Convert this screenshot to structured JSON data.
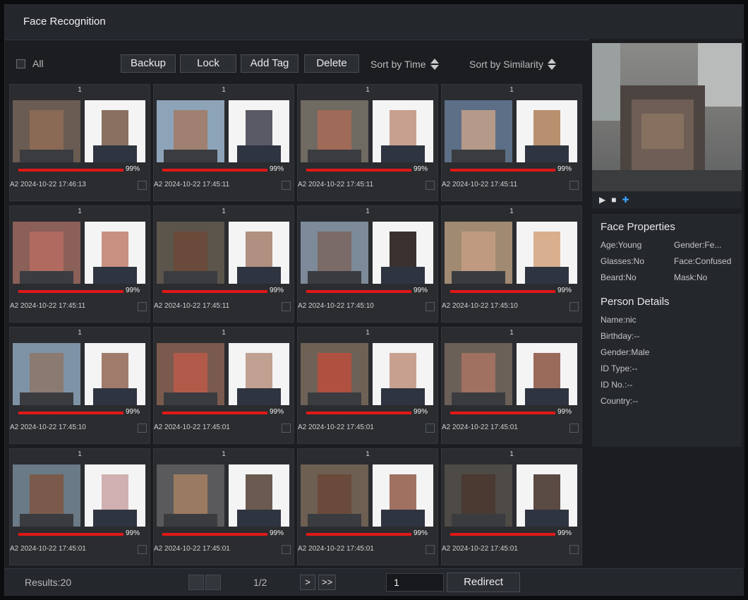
{
  "window": {
    "title": "Face Recognition"
  },
  "toolbar": {
    "all_label": "All",
    "backup_label": "Backup",
    "lock_label": "Lock",
    "add_tag_label": "Add Tag",
    "delete_label": "Delete",
    "sort_time_label": "Sort by Time",
    "sort_similarity_label": "Sort by Similarity"
  },
  "results": [
    {
      "index": "1",
      "similarity": "99%",
      "time": "A2 2024-10-22 17:46:13"
    },
    {
      "index": "1",
      "similarity": "99%",
      "time": "A2 2024-10-22 17:45:11"
    },
    {
      "index": "1",
      "similarity": "99%",
      "time": "A2 2024-10-22 17:45:11"
    },
    {
      "index": "1",
      "similarity": "99%",
      "time": "A2 2024-10-22 17:45:11"
    },
    {
      "index": "1",
      "similarity": "99%",
      "time": "A2 2024-10-22 17:45:11"
    },
    {
      "index": "1",
      "similarity": "99%",
      "time": "A2 2024-10-22 17:45:11"
    },
    {
      "index": "1",
      "similarity": "99%",
      "time": "A2 2024-10-22 17:45:10"
    },
    {
      "index": "1",
      "similarity": "99%",
      "time": "A2 2024-10-22 17:45:10"
    },
    {
      "index": "1",
      "similarity": "99%",
      "time": "A2 2024-10-22 17:45:10"
    },
    {
      "index": "1",
      "similarity": "99%",
      "time": "A2 2024-10-22 17:45:01"
    },
    {
      "index": "1",
      "similarity": "99%",
      "time": "A2 2024-10-22 17:45:01"
    },
    {
      "index": "1",
      "similarity": "99%",
      "time": "A2 2024-10-22 17:45:01"
    },
    {
      "index": "1",
      "similarity": "99%",
      "time": "A2 2024-10-22 17:45:01"
    },
    {
      "index": "1",
      "similarity": "99%",
      "time": "A2 2024-10-22 17:45:01"
    },
    {
      "index": "1",
      "similarity": "99%",
      "time": "A2 2024-10-22 17:45:01"
    },
    {
      "index": "1",
      "similarity": "99%",
      "time": "A2 2024-10-22 17:45:01"
    }
  ],
  "side": {
    "face_properties_title": "Face Properties",
    "age": "Age:Young",
    "gender_attr": "Gender:Fe...",
    "glasses": "Glasses:No",
    "face_expr": "Face:Confused",
    "beard": "Beard:No",
    "mask": "Mask:No",
    "person_details_title": "Person Details",
    "name": "Name:nic",
    "birthday": "Birthday:--",
    "gender": "Gender:Male",
    "id_type": "ID Type:--",
    "id_no": "ID No.:--",
    "country": "Country:--"
  },
  "footer": {
    "results_label": "Results:20",
    "page_info": "1/2",
    "next_label": ">",
    "last_label": ">>",
    "page_input_value": "1",
    "redirect_label": "Redirect"
  }
}
